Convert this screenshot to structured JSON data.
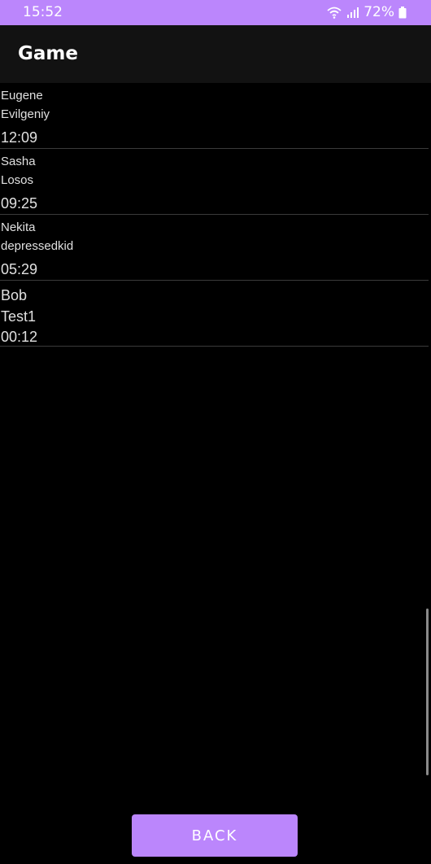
{
  "status_bar": {
    "time": "15:52",
    "battery_percent": "72%",
    "icons": [
      "wifi-icon",
      "signal-icon",
      "battery-icon"
    ],
    "background_color": "#bb86fc"
  },
  "app_bar": {
    "title": "Game",
    "background_color": "#121212"
  },
  "entries": [
    {
      "name": "Eugene",
      "nickname": "Evilgeniy",
      "time": "12:09"
    },
    {
      "name": "Sasha",
      "nickname": "Losos",
      "time": "09:25"
    },
    {
      "name": "Nekita",
      "nickname": "depressedkid",
      "time": "05:29"
    },
    {
      "name": "Bob",
      "nickname": "Test1",
      "time": "00:12"
    }
  ],
  "back_button": {
    "label": "BACK",
    "color": "#bb86fc"
  }
}
